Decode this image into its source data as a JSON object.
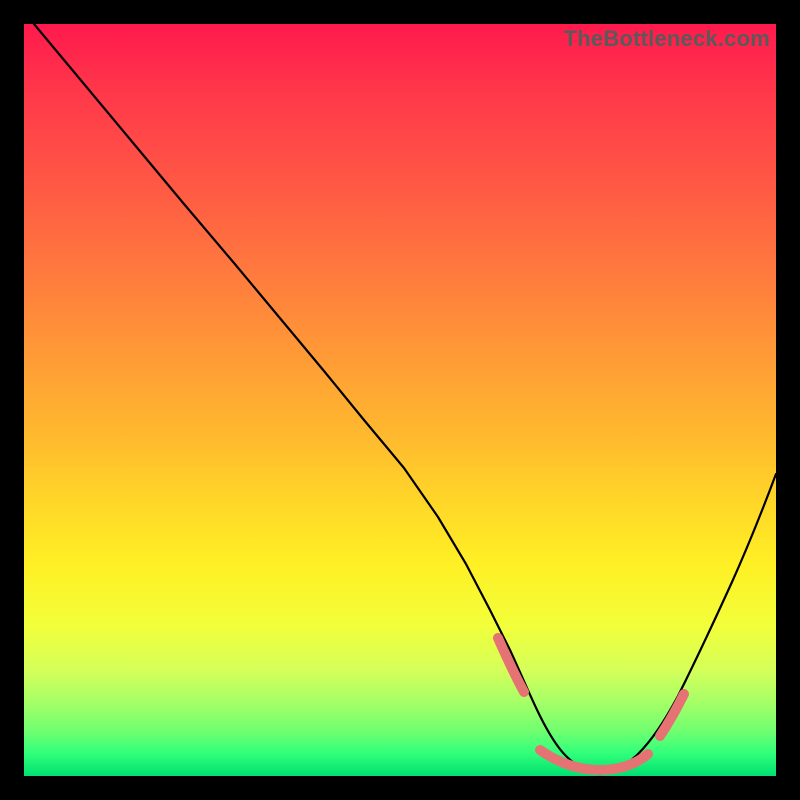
{
  "watermark": "TheBottleneck.com",
  "chart_data": {
    "type": "line",
    "title": "",
    "xlabel": "",
    "ylabel": "",
    "xlim": [
      0,
      100
    ],
    "ylim": [
      0,
      100
    ],
    "grid": false,
    "legend": false,
    "series": [
      {
        "name": "bottleneck-curve",
        "x": [
          0,
          5,
          10,
          15,
          20,
          25,
          30,
          35,
          40,
          45,
          50,
          55,
          58,
          60,
          63,
          66,
          70,
          74,
          78,
          82,
          86,
          90,
          94,
          100
        ],
        "y": [
          100,
          94,
          88,
          82,
          75,
          69,
          62,
          55,
          48,
          41,
          33,
          24,
          17,
          12,
          7,
          3,
          1,
          0,
          1,
          4,
          10,
          18,
          28,
          46
        ]
      }
    ],
    "annotations": [
      {
        "name": "valley-marker-left",
        "x_range": [
          58,
          64
        ],
        "y_approx": 9
      },
      {
        "name": "valley-marker-right",
        "x_range": [
          77,
          83
        ],
        "y_approx": 5
      }
    ],
    "colors": {
      "curve": "#000000",
      "marker": "#e57373",
      "gradient_top": "#ff1a4d",
      "gradient_bottom": "#00e070",
      "frame": "#000000"
    }
  }
}
